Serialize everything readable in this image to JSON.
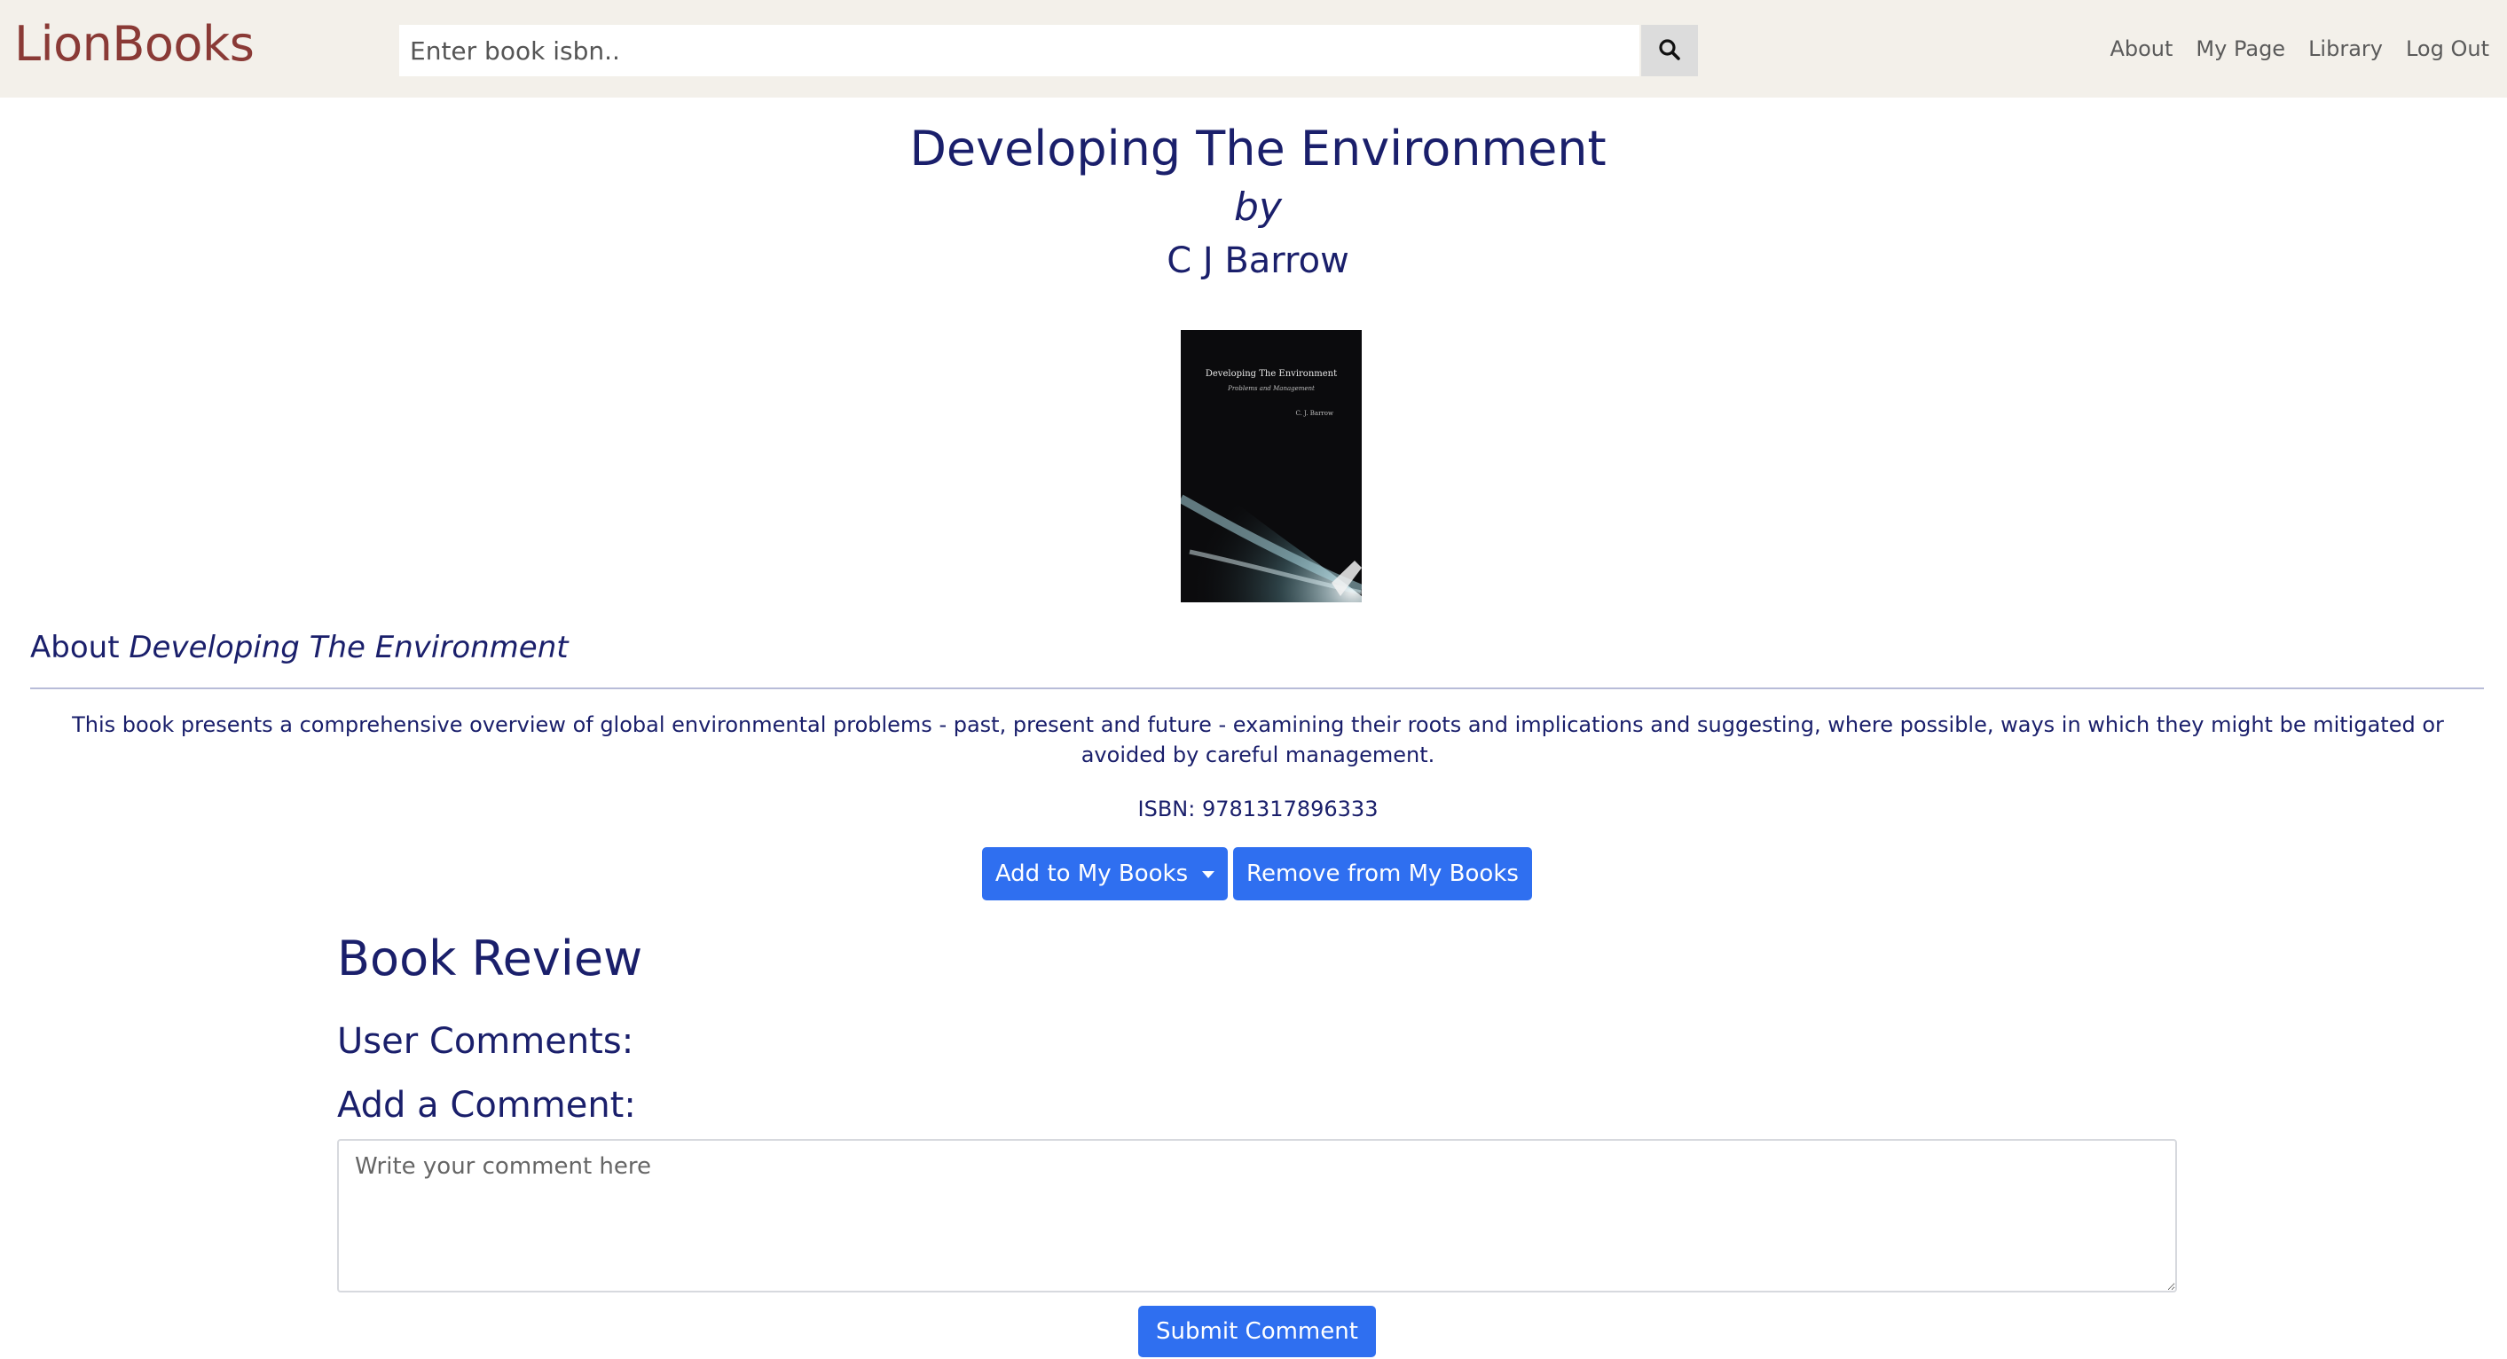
{
  "navbar": {
    "brand": "LionBooks",
    "search_placeholder": "Enter book isbn..",
    "search_icon": "search-icon",
    "links": [
      "About",
      "My Page",
      "Library",
      "Log Out"
    ]
  },
  "book": {
    "title": "Developing The Environment",
    "by": "by",
    "author": "C J Barrow",
    "cover": {
      "title": "Developing The Environment",
      "subtitle": "Problems and Management",
      "author": "C. J. Barrow"
    }
  },
  "about": {
    "prefix": "About",
    "title": "Developing The Environment",
    "description": "This book presents a comprehensive overview of global environmental problems - past, present and future - examining their roots and implications and suggesting, where possible, ways in which they might be mitigated or avoided by careful management.",
    "isbn": "ISBN: 9781317896333"
  },
  "actions": {
    "add_label": "Add to My Books",
    "remove_label": "Remove from My Books"
  },
  "review": {
    "title": "Book Review",
    "user_comments": "User Comments:",
    "add_comment": "Add a Comment:",
    "comment_placeholder": "Write your comment here",
    "submit_label": "Submit Comment"
  },
  "colors": {
    "brand": "#8a3a36",
    "navbar_bg": "#f3f0ea",
    "heading_text": "#1a1f6b",
    "button_primary": "#2f6ff0"
  }
}
